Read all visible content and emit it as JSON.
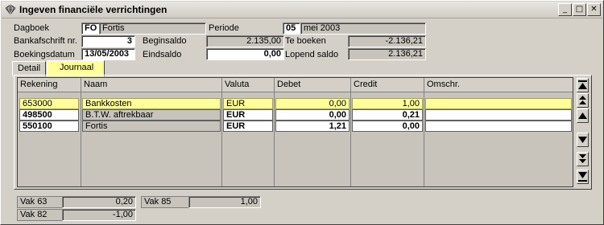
{
  "window": {
    "title": "Ingeven financiële verrichtingen",
    "min_glyph": "_",
    "max_glyph": "□",
    "close_glyph": "✕"
  },
  "header": {
    "dagboek_label": "Dagboek",
    "dagboek_code": "FO",
    "dagboek_name": "Fortis",
    "periode_label": "Periode",
    "periode_num": "05",
    "periode_name": "mei 2003",
    "bankafschrift_label": "Bankafschrift nr.",
    "bankafschrift_value": "3",
    "beginsaldo_label": "Beginsaldo",
    "beginsaldo_value": "2.135,00",
    "te_boeken_label": "Te boeken",
    "te_boeken_value": "-2.136,21",
    "boekingsdatum_label": "Boekingsdatum",
    "boekingsdatum_value": "13/05/2003",
    "eindsaldo_label": "Eindsaldo",
    "eindsaldo_value": "0,00",
    "lopend_saldo_label": "Lopend saldo",
    "lopend_saldo_value": "2.136,21"
  },
  "tabs": [
    {
      "label": "Detail"
    },
    {
      "label": "Journaal"
    }
  ],
  "table": {
    "columns": [
      "Rekening",
      "Naam",
      "Valuta",
      "Debet",
      "Credit",
      "Omschr."
    ],
    "rows": [
      {
        "rekening": "653000",
        "naam": "Bankkosten",
        "valuta": "EUR",
        "debet": "0,00",
        "credit": "1,00",
        "omschr": ""
      },
      {
        "rekening": "498500",
        "naam": "B.T.W. aftrekbaar",
        "valuta": "EUR",
        "debet": "0,00",
        "credit": "0,21",
        "omschr": ""
      },
      {
        "rekening": "550100",
        "naam": "Fortis",
        "valuta": "EUR",
        "debet": "1,21",
        "credit": "0,00",
        "omschr": ""
      }
    ]
  },
  "footer": {
    "vak63_label": "Vak 63",
    "vak63_value": "0,20",
    "vak85_label": "Vak 85",
    "vak85_value": "1,00",
    "vak82_label": "Vak 82",
    "vak82_value": "-1,00"
  },
  "colors": {
    "selected_row": "#ffff99",
    "field_grey": "#c8c4bc",
    "window_bg": "#d4d0c8"
  }
}
